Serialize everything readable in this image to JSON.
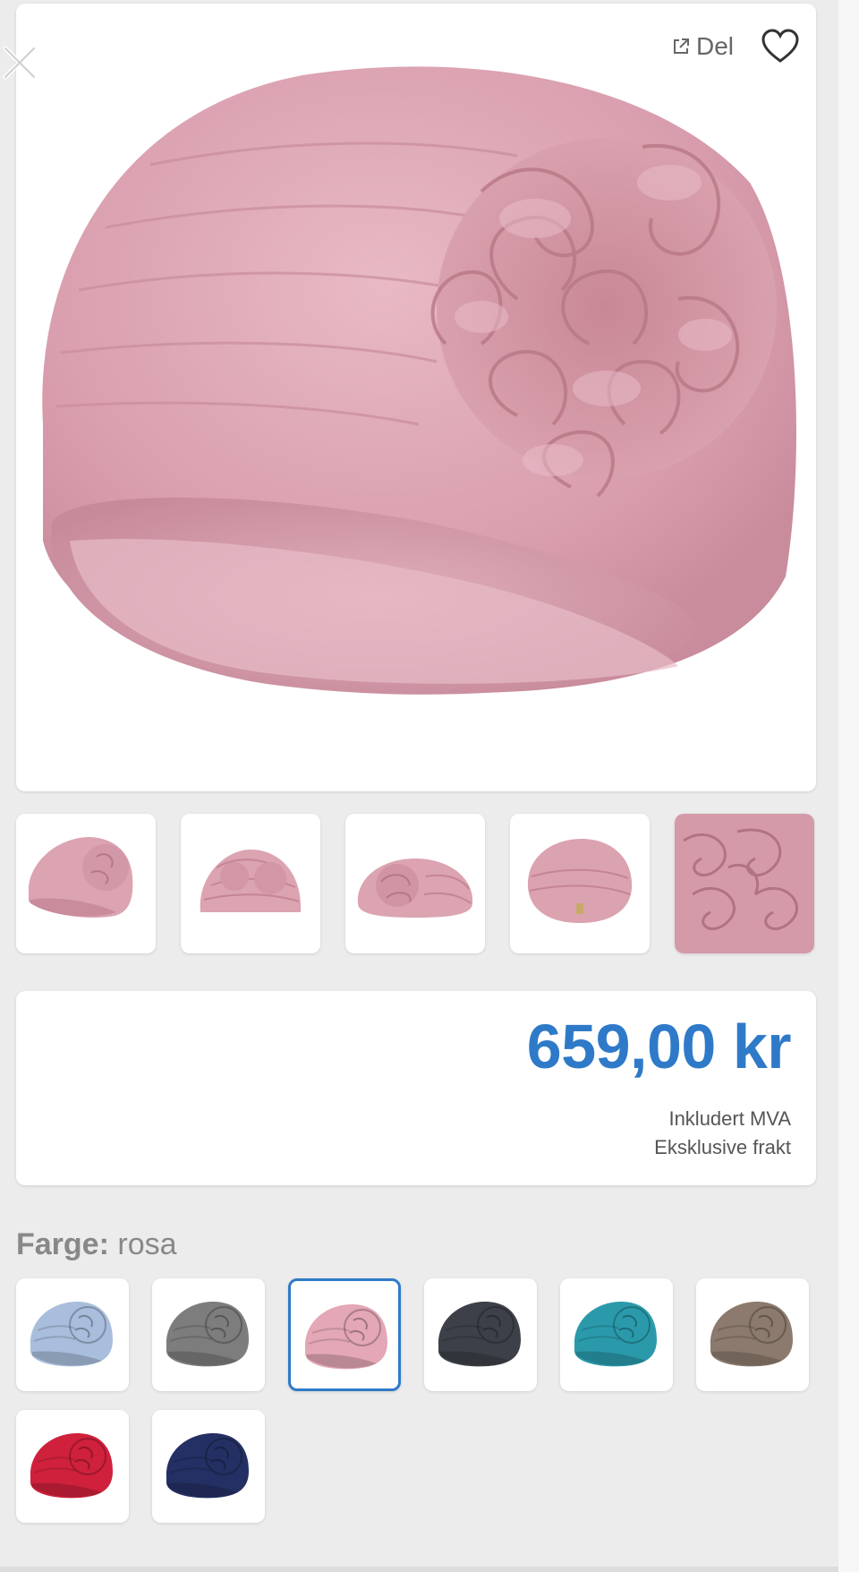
{
  "header": {
    "share_label": "Del"
  },
  "icons": {
    "close": "close-icon",
    "share": "external-link-icon",
    "favorite": "heart-outline-icon"
  },
  "gallery": {
    "thumbnails": [
      "thumb-1",
      "thumb-2",
      "thumb-3",
      "thumb-4",
      "thumb-5"
    ]
  },
  "price": {
    "amount": "659,00 kr",
    "vat_note": "Inkludert MVA",
    "shipping_note": "Eksklusive frakt",
    "color": "#2f7ac8"
  },
  "color_picker": {
    "label": "Farge:",
    "selected_value": "rosa",
    "swatch_colors": [
      "#a9bedc",
      "#7d7d7d",
      "#e3a7b5",
      "#3d4048",
      "#2a9aab",
      "#8b7a6d",
      "#d0213c",
      "#243063"
    ],
    "selected_index": 2
  }
}
